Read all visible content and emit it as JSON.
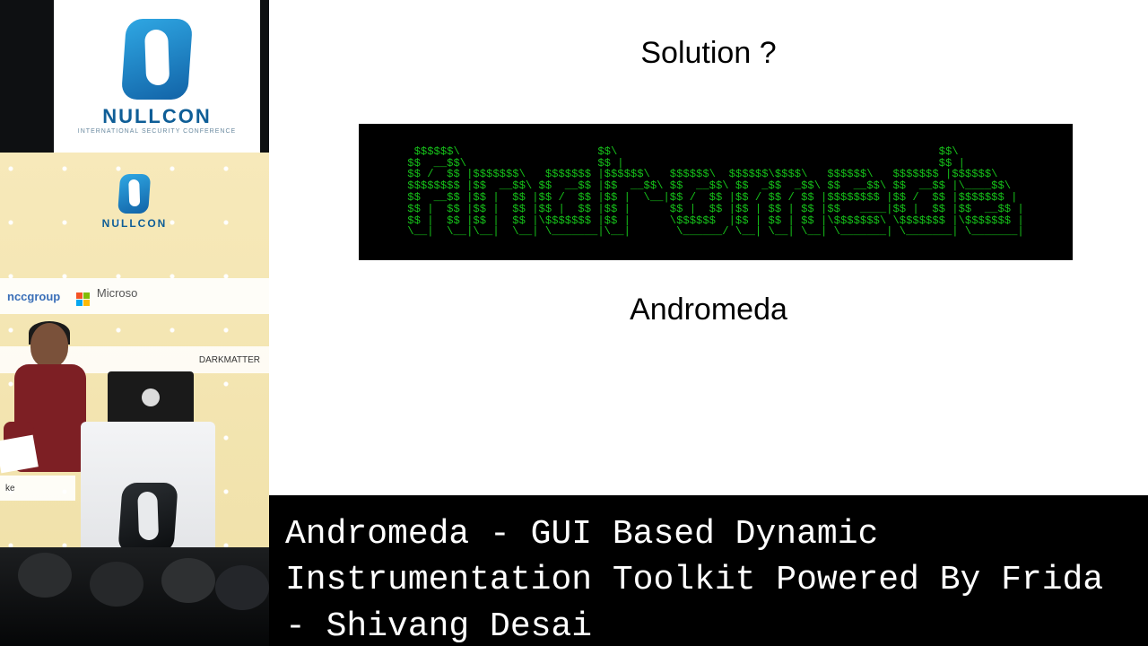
{
  "brand": {
    "word": "NULLCON",
    "sub": "INTERNATIONAL SECURITY CONFERENCE"
  },
  "sponsors": {
    "ncc": "nccgroup",
    "ms": "Microso",
    "dark": "DARKMATTER",
    "row3": "ke"
  },
  "slide": {
    "title": "Solution ?",
    "label": "Andromeda",
    "ascii": "  $$$$$$\\                     $$\\                                                 $$\\           \n $$  __$$\\                    $$ |                                                $$ |          \n $$ /  $$ |$$$$$$$\\   $$$$$$$ |$$$$$$\\   $$$$$$\\  $$$$$$\\$$$$\\   $$$$$$\\   $$$$$$$ |$$$$$$\\    \n $$$$$$$$ |$$  __$$\\ $$  __$$ |$$  __$$\\ $$  __$$\\ $$  _$$  _$$\\ $$  __$$\\ $$  __$$ |\\____$$\\   \n $$  __$$ |$$ |  $$ |$$ /  $$ |$$ |  \\__|$$ /  $$ |$$ / $$ / $$ |$$$$$$$$ |$$ /  $$ |$$$$$$$ |  \n $$ |  $$ |$$ |  $$ |$$ |  $$ |$$ |      $$ |  $$ |$$ | $$ | $$ |$$   ____|$$ |  $$ |$$  __$$ | \n $$ |  $$ |$$ |  $$ |\\$$$$$$$ |$$ |      \\$$$$$$  |$$ | $$ | $$ |\\$$$$$$$\\ \\$$$$$$$ |\\$$$$$$$ | \n \\__|  \\__|\\__|  \\__| \\_______|\\__|       \\______/ \\__| \\__| \\__| \\_______| \\_______| \\_______|"
  },
  "caption": {
    "line1": "Andromeda - GUI Based Dynamic",
    "line2": "Instrumentation Toolkit Powered By Frida",
    "line3": " - Shivang Desai"
  }
}
